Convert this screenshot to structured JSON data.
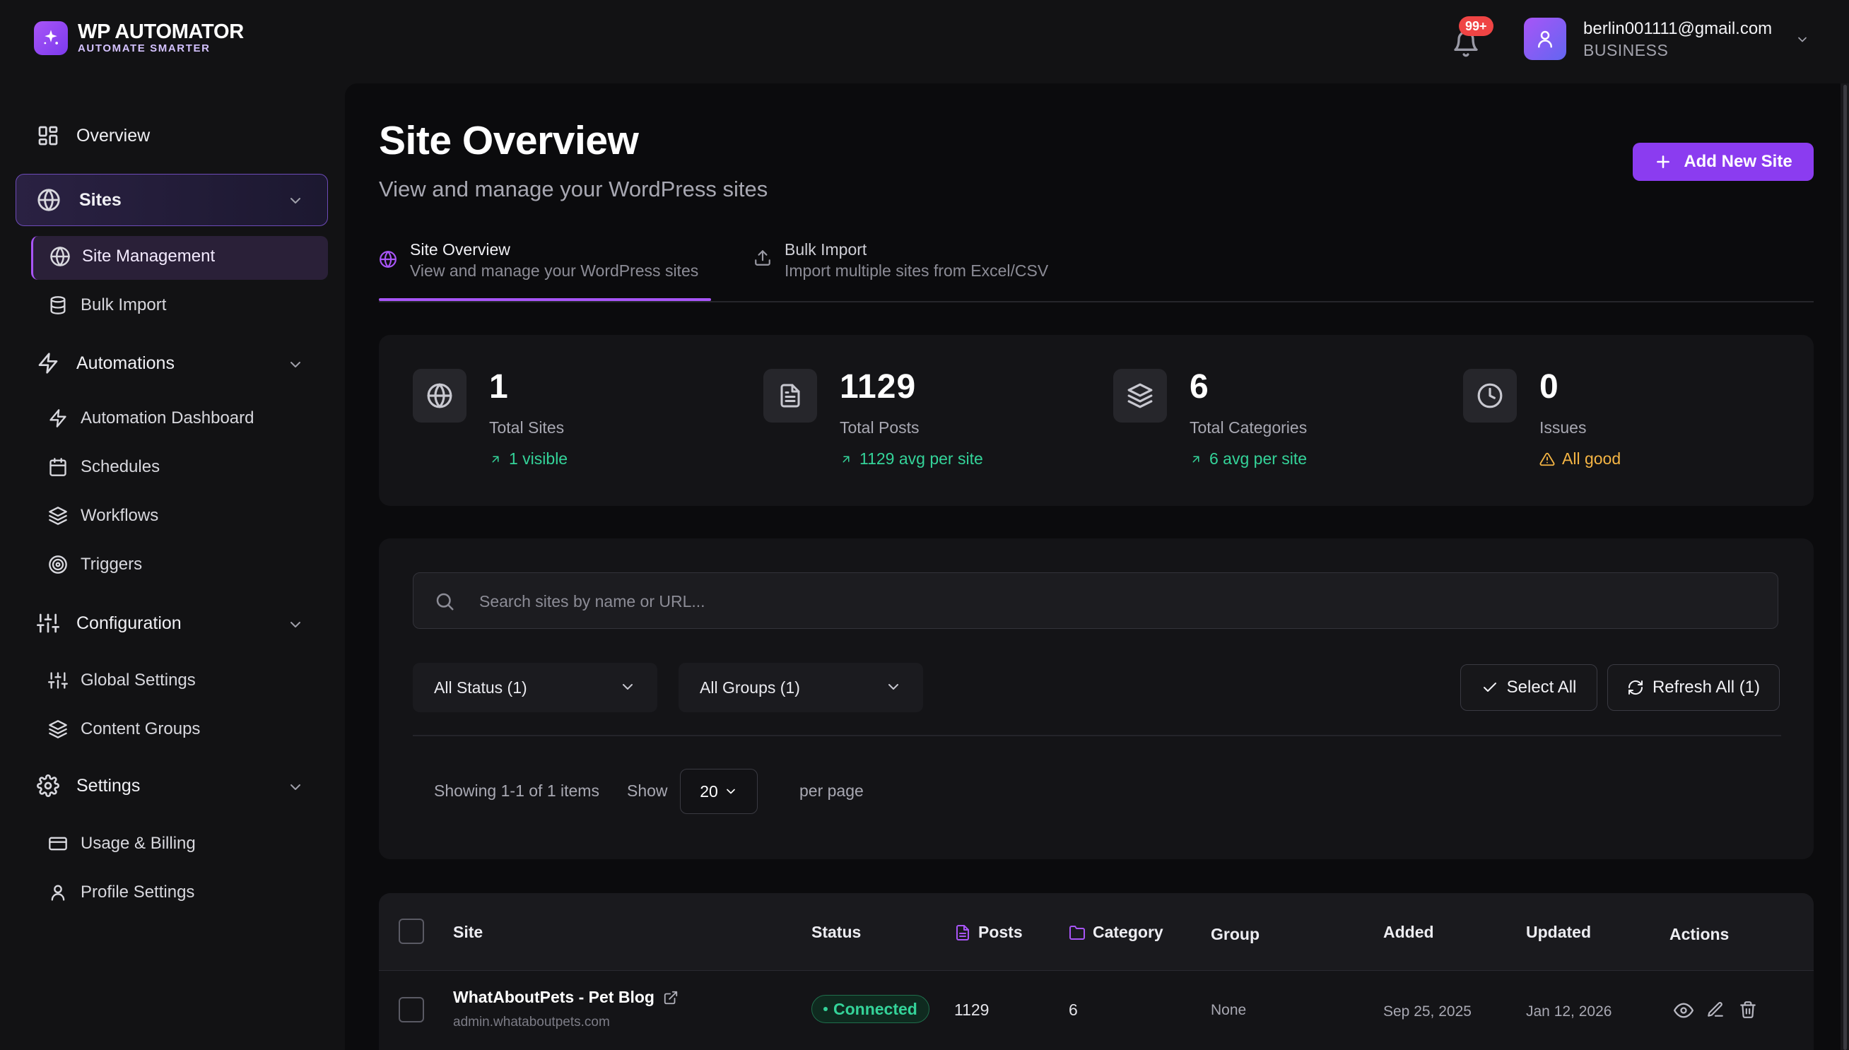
{
  "header": {
    "brand_title": "WP AUTOMATOR",
    "brand_subtitle": "AUTOMATE SMARTER",
    "notifications_badge": "99+",
    "user_email": "berlin001111@gmail.com",
    "user_plan": "BUSINESS"
  },
  "sidebar": {
    "overview": "Overview",
    "sites": "Sites",
    "site_management": "Site Management",
    "bulk_import": "Bulk Import",
    "automations": "Automations",
    "automation_dashboard": "Automation Dashboard",
    "schedules": "Schedules",
    "workflows": "Workflows",
    "triggers": "Triggers",
    "configuration": "Configuration",
    "global_settings": "Global Settings",
    "content_groups": "Content Groups",
    "settings": "Settings",
    "usage_billing": "Usage & Billing",
    "profile_settings": "Profile Settings"
  },
  "page": {
    "title": "Site Overview",
    "subtitle": "View and manage your WordPress sites",
    "add_button": "Add New Site"
  },
  "tabs": [
    {
      "title": "Site Overview",
      "subtitle": "View and manage your WordPress sites"
    },
    {
      "title": "Bulk Import",
      "subtitle": "Import multiple sites from Excel/CSV"
    }
  ],
  "stats": [
    {
      "value": "1",
      "label": "Total Sites",
      "trend": "1 visible"
    },
    {
      "value": "1129",
      "label": "Total Posts",
      "trend": "1129 avg per site"
    },
    {
      "value": "6",
      "label": "Total Categories",
      "trend": "6 avg per site"
    },
    {
      "value": "0",
      "label": "Issues",
      "trend": "All good"
    }
  ],
  "filters": {
    "search_placeholder": "Search sites by name or URL...",
    "status_select": "All Status (1)",
    "groups_select": "All Groups (1)",
    "select_all": "Select All",
    "refresh_all": "Refresh All (1)",
    "showing": "Showing 1-1 of 1 items",
    "show": "Show",
    "per_page_value": "20",
    "per_page": "per page"
  },
  "table": {
    "headers": {
      "site": "Site",
      "status": "Status",
      "posts": "Posts",
      "category": "Category",
      "group": "Group",
      "added": "Added",
      "updated": "Updated",
      "actions": "Actions"
    },
    "rows": [
      {
        "name": "WhatAboutPets - Pet Blog",
        "url": "admin.whataboutpets.com",
        "status": "Connected",
        "posts": "1129",
        "category": "6",
        "group": "None",
        "added": "Sep 25, 2025",
        "updated": "Jan 12, 2026"
      }
    ]
  },
  "colors": {
    "accent": "#8b3cf0",
    "success": "#34d399",
    "warning": "#f5b544",
    "badge": "#ef4444"
  }
}
